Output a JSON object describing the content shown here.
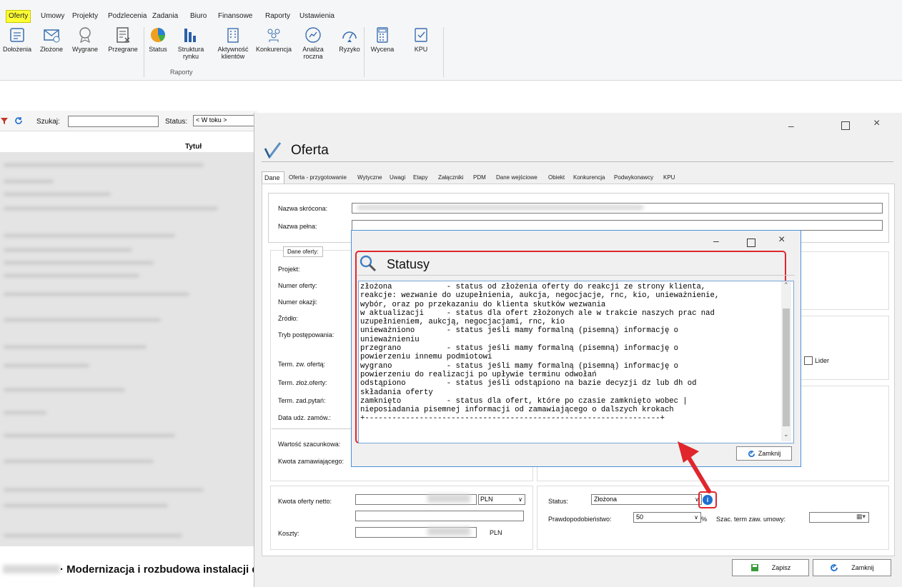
{
  "menu": [
    "Oferty",
    "Umowy",
    "Projekty",
    "Podzlecenia",
    "Zadania",
    "Biuro",
    "Finansowe",
    "Raporty",
    "Ustawienia"
  ],
  "ribbon": {
    "buttons": [
      {
        "label": "Dołożenia",
        "icon": "document-stack-icon"
      },
      {
        "label": "Złożone",
        "icon": "envelope-check-icon"
      },
      {
        "label": "Wygrane",
        "icon": "award-icon"
      },
      {
        "label": "Przegrane",
        "icon": "document-x-icon"
      },
      {
        "label": "Status",
        "icon": "pie-chart-icon"
      },
      {
        "label": "Struktura rynku",
        "icon": "bar-chart-icon"
      },
      {
        "label": "Aktywność klientów",
        "icon": "building-icon"
      },
      {
        "label": "Konkurencja",
        "icon": "people-icon"
      },
      {
        "label": "Analiza roczna",
        "icon": "gauge-icon"
      },
      {
        "label": "Ryzyko",
        "icon": "risk-gauge-icon"
      },
      {
        "label": "Wycena",
        "icon": "calculator-icon"
      },
      {
        "label": "KPU",
        "icon": "checklist-icon"
      }
    ],
    "group_label": "Raporty"
  },
  "main_toolbar": {
    "search_label": "Szukaj:",
    "status_label": "Status:",
    "status_value": "< W toku >",
    "column_title": "Tytuł"
  },
  "bottom_title": "· Modernizacja i rozbudowa instalacji d",
  "oferta": {
    "title": "Oferta",
    "tabs": [
      "Dane",
      "Oferta - przygotowanie",
      "Wytyczne",
      "Uwagi",
      "Etapy",
      "Załączniki",
      "PDM",
      "Dane wejściowe",
      "Obiekt",
      "Konkurencja",
      "Podwykonawcy",
      "KPU"
    ],
    "labels": {
      "nazwa_skrocona": "Nazwa skrócona:",
      "nazwa_pelna": "Nazwa pełna:",
      "dane_oferty": "Dane oferty:",
      "projekt": "Projekt:",
      "numer_oferty": "Numer oferty:",
      "numer_okazji": "Numer okazji:",
      "zrodlo": "Źródło:",
      "tryb": "Tryb postępowania:",
      "term_zw": "Term. zw. ofertą:",
      "term_zloz": "Term. złoż.oferty:",
      "term_zad": "Term. zad.pytań:",
      "data_udz": "Data udz. zamów.:",
      "wartosc": "Wartość szacunkowa:",
      "kwota_zam": "Kwota zamawiającego:",
      "kwota_oferty": "Kwota oferty netto:",
      "koszty": "Koszty:",
      "lider": "Lider",
      "status": "Status:",
      "prawdopodobienstwo": "Prawdopodobieństwo:",
      "szac_term": "Szac. term zaw. umowy:"
    },
    "currency": "PLN",
    "currency_2": "PLN",
    "status_value": "Złożona",
    "probability": "50",
    "percent": "%",
    "save_label": "Zapisz",
    "close_label": "Zamknij"
  },
  "statusy": {
    "title": "Statusy",
    "text": "złożona            - status od złożenia oferty do reakcji ze strony klienta,\nreakcje: wezwanie do uzupełnienia, aukcja, negocjacje, rnc, kio, unieważnienie,\nwybór, oraz po przekazaniu do klienta skutków wezwania\nw aktualizacji     - status dla ofert złożonych ale w trakcie naszych prac nad\nuzupełnieniem, aukcją, negocjacjami, rnc, kio\nunieważniono       - status jeśli mamy formalną (pisemną) informację o\nunieważnieniu\nprzegrano          - status jeśli mamy formalną (pisemną) informację o\npowierzeniu innemu podmiotowi\nwygrano            - status jeśli mamy formalną (pisemną) informację o\npowierzeniu do realizacji po upływie terminu odwołań\nodstąpiono         - status jeśli odstąpiono na bazie decyzji dz lub dh od\nskładania oferty\nzamknięto          - status dla ofert, które po czasie zamknięto wobec |\nnieposiadania pisemnej informacji od zamawiającego o dalszych krokach\n+-----------------------------------------------------------------+",
    "close_label": "Zamknij"
  },
  "colors": {
    "highlight": "#e0262c",
    "accent": "#1e6fd1",
    "menu_active": "#ffff33"
  }
}
